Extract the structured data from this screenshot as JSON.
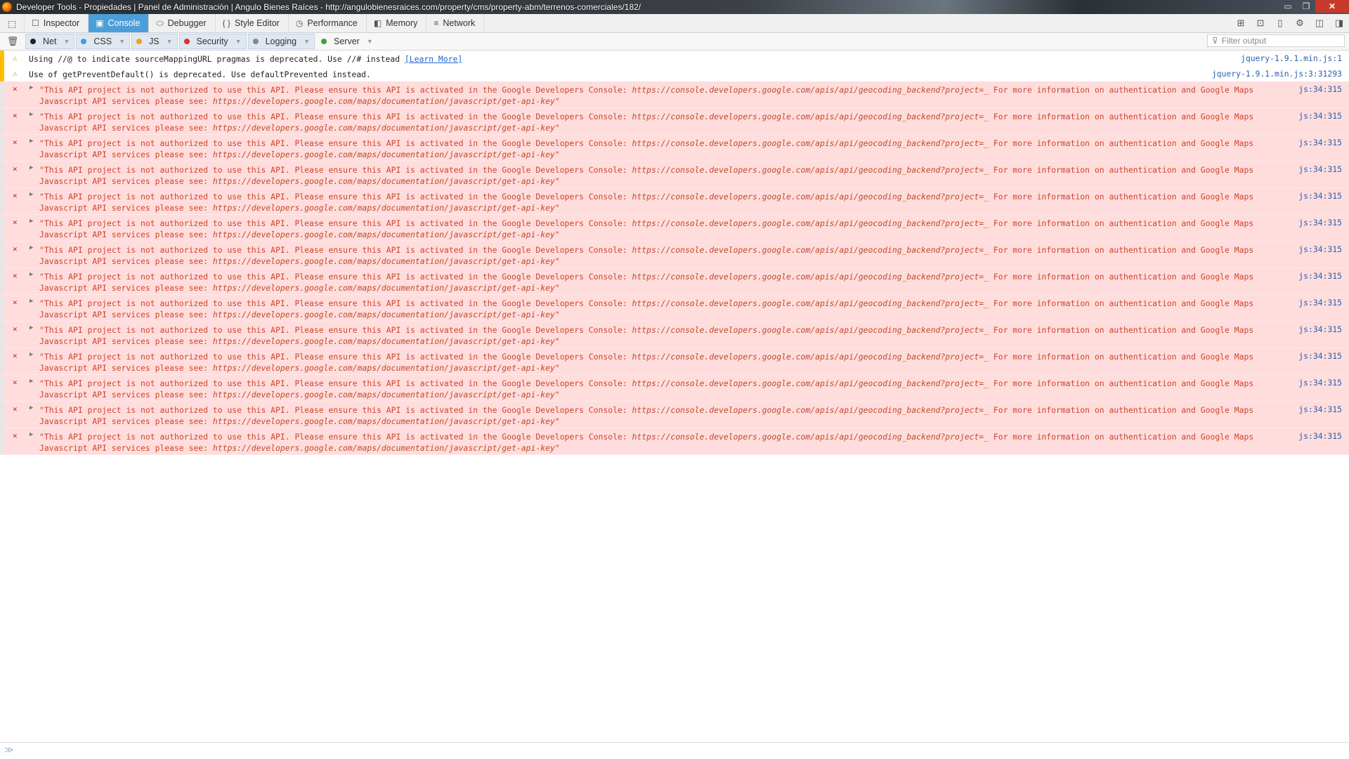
{
  "window": {
    "title": "Developer Tools - Propiedades | Panel de Administración | Angulo Bienes Raíces - http://angulobienesraices.com/property/cms/property-abm/terrenos-comerciales/182/",
    "minimize": "▭",
    "restore": "❐",
    "close": "✕"
  },
  "toolbar": {
    "tabs": [
      {
        "label": "Inspector",
        "icon": "☐"
      },
      {
        "label": "Console",
        "icon": "▣"
      },
      {
        "label": "Debugger",
        "icon": "⬭"
      },
      {
        "label": "Style Editor",
        "icon": "{ }"
      },
      {
        "label": "Performance",
        "icon": "◷"
      },
      {
        "label": "Memory",
        "icon": "◧"
      },
      {
        "label": "Network",
        "icon": "≡"
      }
    ],
    "selected_tab": "Console"
  },
  "filters": {
    "items": [
      {
        "label": "Net",
        "color": "#222222",
        "active": true
      },
      {
        "label": "CSS",
        "color": "#3aa0e0",
        "active": true
      },
      {
        "label": "JS",
        "color": "#f0a020",
        "active": true
      },
      {
        "label": "Security",
        "color": "#e03030",
        "active": true
      },
      {
        "label": "Logging",
        "color": "#888888",
        "active": true
      },
      {
        "label": "Server",
        "color": "#40a040",
        "active": false
      }
    ],
    "filter_placeholder": "Filter output"
  },
  "console": {
    "warnings": [
      {
        "text": "Using //@ to indicate sourceMappingURL pragmas is deprecated. Use //# instead",
        "link": "[Learn More]",
        "location": "jquery-1.9.1.min.js:1"
      },
      {
        "text": "Use of getPreventDefault() is deprecated. Use defaultPrevented instead.",
        "link": "",
        "location": "jquery-1.9.1.min.js:3:31293"
      }
    ],
    "error_line1_text": "\"This API project is not authorized to use this API. Please ensure this API is activated in the Google Developers Console: ",
    "error_line1_url": "https://console.developers.google.com/apis/api/geocoding_backend?project=_",
    "error_line1_tail": " For more information on authentication and Google Maps",
    "error_line2_text": "Javascript API services please see: ",
    "error_line2_url": "https://developers.google.com/maps/documentation/javascript/get-api-key\"",
    "error_location": "js:34:315",
    "error_count": 14
  },
  "icons": {
    "picker": "⬚",
    "trash": "🗑",
    "warn": "⚠",
    "error": "✕",
    "twisty": "▶",
    "filter": "⊽",
    "prompt": "≫",
    "right_tools": [
      "⊞",
      "⊡",
      "▯",
      "⚙",
      "◫",
      "◨"
    ]
  }
}
